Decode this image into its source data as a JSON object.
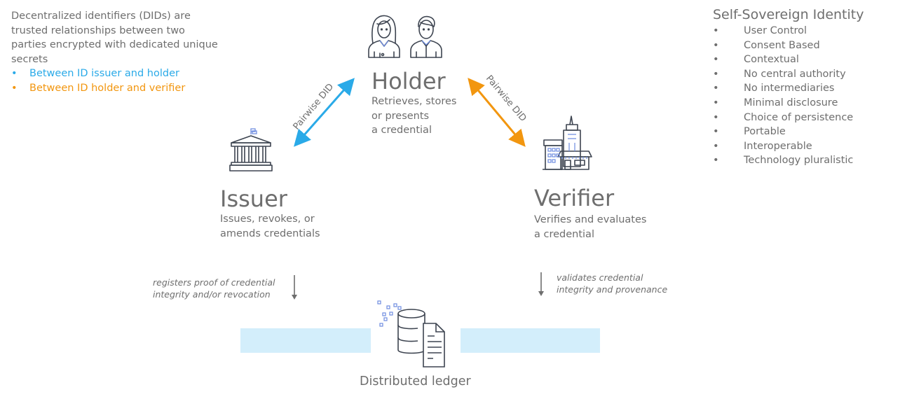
{
  "intro": {
    "text": "Decentralized identifiers (DIDs) are trusted relationships between two parties encrypted with dedicated unique secrets",
    "bullets": [
      {
        "label": "Between ID issuer and holder",
        "color": "#2aaae8"
      },
      {
        "label": "Between ID holder and verifier",
        "color": "#f2960f"
      }
    ],
    "bullet_glyph": "•"
  },
  "ssi": {
    "title": "Self-Sovereign Identity",
    "items": [
      "User Control",
      "Consent Based",
      "Contextual",
      "No central authority",
      "No intermediaries",
      "Minimal disclosure",
      "Choice of persistence",
      "Portable",
      "Interoperable",
      "Technology pluralistic"
    ],
    "bullet_glyph": "•"
  },
  "roles": {
    "holder": {
      "title": "Holder",
      "desc_lines": [
        "Retrieves, stores",
        "or presents",
        "a credential"
      ],
      "icon": "people-icon"
    },
    "issuer": {
      "title": "Issuer",
      "desc_lines": [
        "Issues, revokes, or",
        "amends credentials"
      ],
      "icon": "government-building-icon"
    },
    "verifier": {
      "title": "Verifier",
      "desc_lines": [
        "Verifies and evaluates",
        "a credential"
      ],
      "icon": "city-buildings-icon"
    }
  },
  "arrows": {
    "issuer_holder": {
      "label": "Pairwise DID",
      "color": "#2aaae8"
    },
    "holder_verifier": {
      "label": "Pairwise DID",
      "color": "#f2960f"
    }
  },
  "notes": {
    "issuer": [
      "registers proof of credential",
      "integrity and/or revocation"
    ],
    "verifier": [
      "validates credential",
      "integrity and provenance"
    ]
  },
  "ledger": {
    "label": "Distributed ledger",
    "band_color": "#d3eefb",
    "icon": "database-document-icon"
  }
}
